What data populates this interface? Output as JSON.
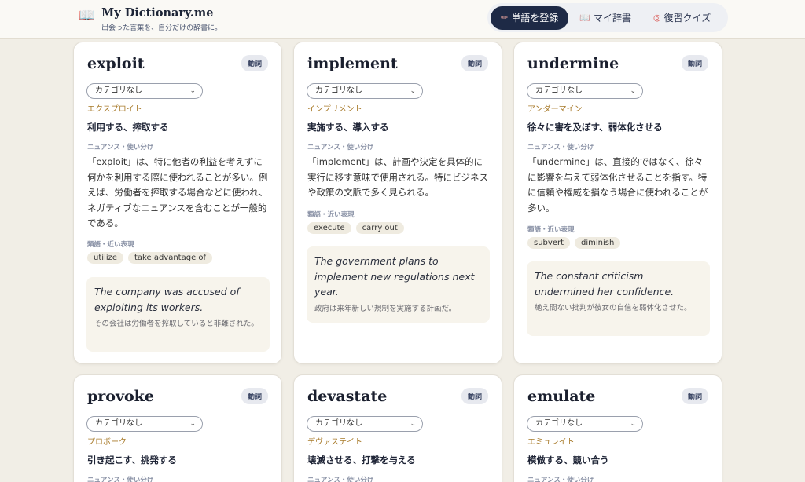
{
  "app": {
    "title": "My Dictionary.me",
    "subtitle": "出会った言葉を、自分だけの辞書に。",
    "logo_icon": "open-book-icon"
  },
  "nav": {
    "register": {
      "label": "単語を登録",
      "icon": "pen-icon"
    },
    "dictionary": {
      "label": "マイ辞書",
      "icon": "book-icon"
    },
    "quiz": {
      "label": "復習クイズ",
      "icon": "target-icon"
    }
  },
  "labels": {
    "nuance": "ニュアンス・使い分け",
    "synonyms": "類語・近い表現"
  },
  "colors": {
    "accent_dark": "#1e2a46",
    "reading": "#a87a2a",
    "background": "#f1eee6"
  },
  "cards": [
    {
      "word": "exploit",
      "pos": "動詞",
      "category": "カテゴリなし",
      "reading": "エクスプロイト",
      "meaning": "利用する、搾取する",
      "nuance": "「exploit」は、特に他者の利益を考えずに何かを利用する際に使われることが多い。例えば、労働者を搾取する場合などに使われ、ネガティブなニュアンスを含むことが一般的である。",
      "synonyms": [
        "utilize",
        "take advantage of"
      ],
      "example_en": "The company was accused of exploiting its workers.",
      "example_ja": "その会社は労働者を搾取していると非難された。"
    },
    {
      "word": "implement",
      "pos": "動詞",
      "category": "カテゴリなし",
      "reading": "インプリメント",
      "meaning": "実施する、導入する",
      "nuance": "「implement」は、計画や決定を具体的に実行に移す意味で使用される。特にビジネスや政策の文脈で多く見られる。",
      "synonyms": [
        "execute",
        "carry out"
      ],
      "example_en": "The government plans to implement new regulations next year.",
      "example_ja": "政府は来年新しい規制を実施する計画だ。"
    },
    {
      "word": "undermine",
      "pos": "動詞",
      "category": "カテゴリなし",
      "reading": "アンダーマイン",
      "meaning": "徐々に害を及ぼす、弱体化させる",
      "nuance": "「undermine」は、直接的ではなく、徐々に影響を与えて弱体化させることを指す。特に信頼や権威を損なう場合に使われることが多い。",
      "synonyms": [
        "subvert",
        "diminish"
      ],
      "example_en": "The constant criticism undermined her confidence.",
      "example_ja": "絶え間ない批判が彼女の自信を弱体化させた。"
    },
    {
      "word": "provoke",
      "pos": "動詞",
      "category": "カテゴリなし",
      "reading": "プロボーク",
      "meaning": "引き起こす、挑発する"
    },
    {
      "word": "devastate",
      "pos": "動詞",
      "category": "カテゴリなし",
      "reading": "デヴァステイト",
      "meaning": "壊滅させる、打撃を与える"
    },
    {
      "word": "emulate",
      "pos": "動詞",
      "category": "カテゴリなし",
      "reading": "エミュレイト",
      "meaning": "模倣する、競い合う"
    }
  ]
}
